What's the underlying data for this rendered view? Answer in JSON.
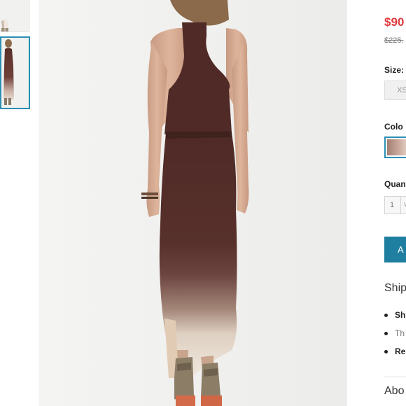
{
  "gallery": {
    "thumbnails": [
      {
        "name": "front view",
        "selected": false
      },
      {
        "name": "back view",
        "selected": true
      }
    ]
  },
  "product": {
    "price": "$90",
    "original_price": "$225."
  },
  "size": {
    "label": "Size:",
    "option_visible": "XS"
  },
  "color": {
    "label": "Colo",
    "swatch_colors": [
      "#a27f72",
      "#c9a89b",
      "#e8d8cf"
    ]
  },
  "quantity": {
    "label": "Quan",
    "value": "1"
  },
  "cart": {
    "button_label": "A"
  },
  "shipping": {
    "heading": "Ship",
    "items": [
      {
        "text": "Sh",
        "style": "bold"
      },
      {
        "text": "Th",
        "style": "light"
      },
      {
        "text": "Re",
        "style": "bold"
      }
    ]
  },
  "about": {
    "heading": "Abo"
  },
  "colors": {
    "accent_blue": "#1f7fa0",
    "selected_border": "#2a8fb3",
    "sale_price": "#e0393e"
  }
}
